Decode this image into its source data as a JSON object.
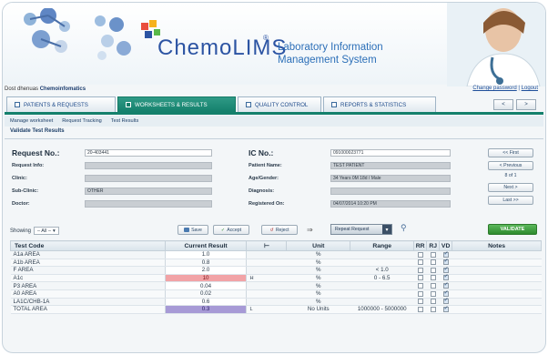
{
  "brand": {
    "logo_text": "ChemoLIMS",
    "registered_mark": "®",
    "tagline_line1": "Laboratory Information",
    "tagline_line2": "Management System"
  },
  "header": {
    "user_label": "Dost dhenuas",
    "user_name": "Chemoinfomatics",
    "change_password": "Change password",
    "logout": "Logout"
  },
  "tabs": [
    {
      "label": "PATIENTS & REQUESTS"
    },
    {
      "label": "WORKSHEETS & RESULTS",
      "active": true
    },
    {
      "label": "QUALITY CONTROL"
    },
    {
      "label": "REPORTS & STATISTICS"
    }
  ],
  "nav_buttons": {
    "prev": "<",
    "next": ">"
  },
  "subnav": [
    "Manage worksheet",
    "Request Tracking",
    "Test Results"
  ],
  "section_title": "Validate Test Results",
  "form_left": {
    "request_no_label": "Request No.:",
    "request_no_value": "20-403441",
    "rows": [
      {
        "label": "Request Info:",
        "value": ""
      },
      {
        "label": "Clinic:",
        "value": ""
      },
      {
        "label": "Sub-Clinic:",
        "value": "OTHER"
      },
      {
        "label": "Doctor:",
        "value": ""
      }
    ]
  },
  "form_right": {
    "ic_no_label": "IC No.:",
    "ic_no_value": "091000023771",
    "rows": [
      {
        "label": "Patient Name:",
        "value": "TEST PATIENT"
      },
      {
        "label": "Age/Gender:",
        "value": "34 Years 0M 18d / Male"
      },
      {
        "label": "Diagnosis:",
        "value": ""
      },
      {
        "label": "Registered On:",
        "value": "04/07/2014 10:20 PM"
      }
    ]
  },
  "side_nav": {
    "first": "<< First",
    "previous": "< Previous",
    "page_info": "8 of 1",
    "next": "Next >",
    "last": "Last >>"
  },
  "toolbar": {
    "showing_label": "Showing",
    "showing_value": "– All –",
    "save": "Save",
    "accept": "Accept",
    "reject": "Reject",
    "result_dropdown": "Repeat Request",
    "validate": "VALIDATE"
  },
  "table": {
    "headers": {
      "test_code": "Test Code",
      "current_result": "Current Result",
      "flag": "",
      "unit": "Unit",
      "range": "Range",
      "rr": "RR",
      "rj": "RJ",
      "vd": "VD",
      "notes": "Notes"
    },
    "rows": [
      {
        "test": "A1a AREA",
        "result": "1.0",
        "flag": "",
        "unit": "%",
        "range": "",
        "status": "",
        "rr": false,
        "rj": false,
        "vd": true
      },
      {
        "test": "A1b AREA",
        "result": "0.8",
        "flag": "",
        "unit": "%",
        "range": "",
        "status": "",
        "rr": false,
        "rj": false,
        "vd": true
      },
      {
        "test": "F AREA",
        "result": "2.0",
        "flag": "",
        "unit": "%",
        "range": "< 1.0",
        "status": "",
        "rr": false,
        "rj": false,
        "vd": true
      },
      {
        "test": "A1c",
        "result": "10",
        "flag": "H",
        "unit": "%",
        "range": "0 - 6.5",
        "status": "high",
        "rr": false,
        "rj": false,
        "vd": true
      },
      {
        "test": "P3 AREA",
        "result": "0.04",
        "flag": "",
        "unit": "%",
        "range": "",
        "status": "",
        "rr": false,
        "rj": false,
        "vd": true
      },
      {
        "test": "A0 AREA",
        "result": "0.02",
        "flag": "",
        "unit": "%",
        "range": "",
        "status": "",
        "rr": false,
        "rj": false,
        "vd": true
      },
      {
        "test": "LA1C/CHB-1A",
        "result": "0.6",
        "flag": "",
        "unit": "%",
        "range": "",
        "status": "",
        "rr": false,
        "rj": false,
        "vd": true
      },
      {
        "test": "TOTAL AREA",
        "result": "0.3",
        "flag": "L",
        "unit": "No Units",
        "range": "1000000 - 5000000",
        "status": "low",
        "rr": false,
        "rj": false,
        "vd": true
      }
    ]
  },
  "colors": {
    "active_tab": "#14806c",
    "high_result": "#f2a3a6",
    "low_result": "#a79ad6",
    "validate": "#3a9a3a",
    "brand_blue": "#2c54a3"
  }
}
